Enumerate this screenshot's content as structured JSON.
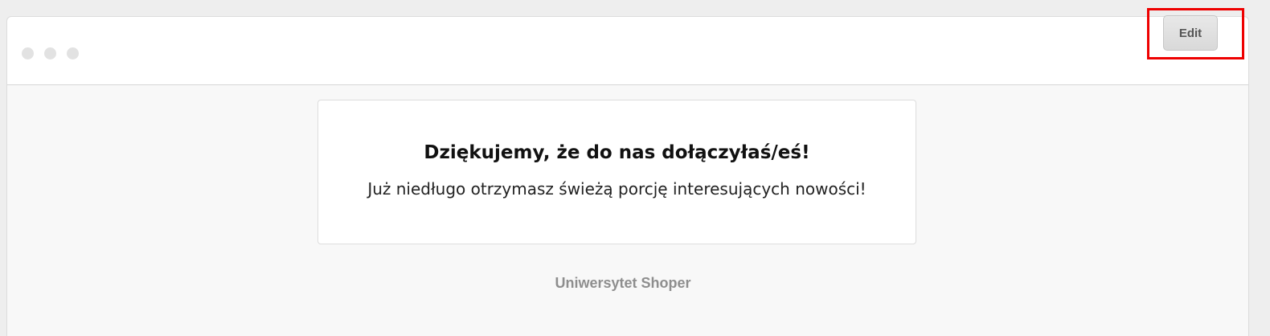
{
  "window": {
    "controls": [
      "window-dot-icon",
      "window-dot-icon",
      "window-dot-icon"
    ]
  },
  "toolbar": {
    "edit_label": "Edit",
    "highlight_color": "#ee0000"
  },
  "message": {
    "headline": "Dziękujemy, że do nas dołączyłaś/eś!",
    "subline": "Już niedługo otrzymasz świeżą porcję interesujących nowości!"
  },
  "footer": {
    "brand": "Uniwersytet Shoper"
  }
}
